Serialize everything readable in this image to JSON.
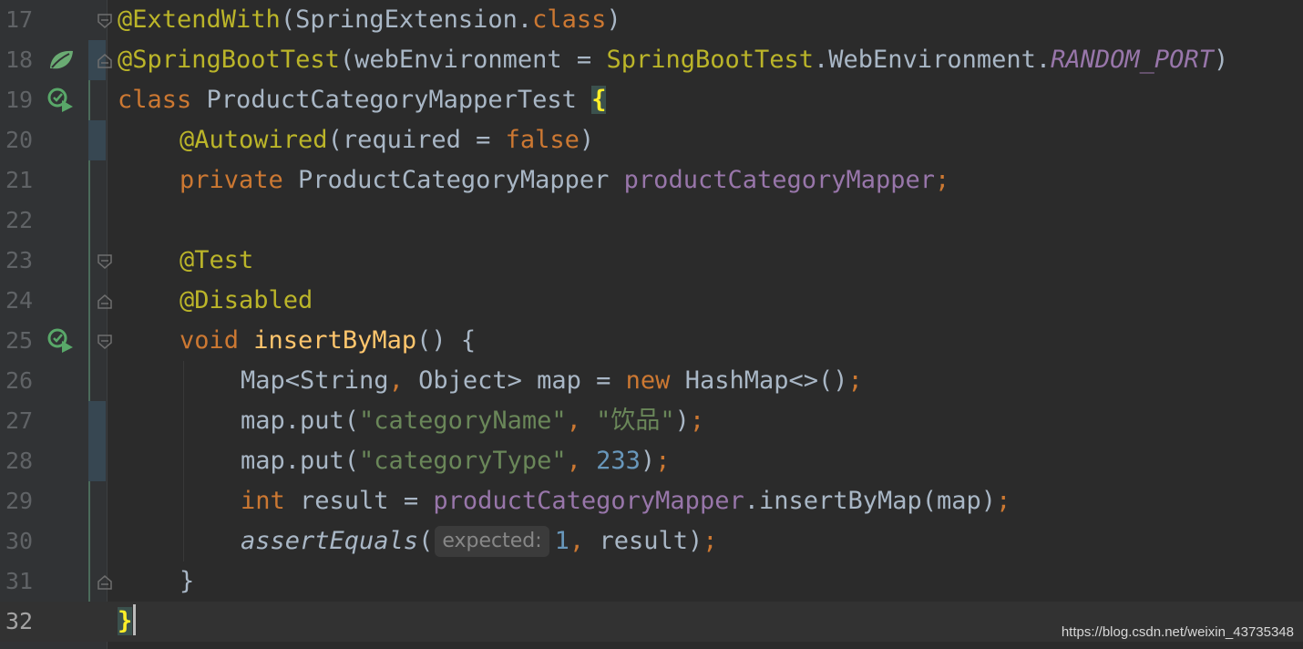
{
  "editor": {
    "lines": [
      {
        "num": "17"
      },
      {
        "num": "18"
      },
      {
        "num": "19"
      },
      {
        "num": "20"
      },
      {
        "num": "21"
      },
      {
        "num": "22"
      },
      {
        "num": "23"
      },
      {
        "num": "24"
      },
      {
        "num": "25"
      },
      {
        "num": "26"
      },
      {
        "num": "27"
      },
      {
        "num": "28"
      },
      {
        "num": "29"
      },
      {
        "num": "30"
      },
      {
        "num": "31"
      },
      {
        "num": "32"
      }
    ],
    "code": {
      "l17": {
        "a": "@ExtendWith",
        "b": "(SpringExtension.",
        "c": "class",
        "d": ")"
      },
      "l18": {
        "a": "@SpringBootTest",
        "b": "(webEnvironment = ",
        "c": "SpringBootTest",
        "d": ".WebEnvironment.",
        "e": "RANDOM_PORT",
        "f": ")"
      },
      "l19": {
        "a": "class ",
        "b": "ProductCategoryMapperTest ",
        "c": "{"
      },
      "l20": {
        "a": "@Autowired",
        "b": "(required = ",
        "c": "false",
        "d": ")"
      },
      "l21": {
        "a": "private ",
        "b": "ProductCategoryMapper ",
        "c": "productCategoryMapper",
        "d": ";"
      },
      "l23": {
        "a": "@Test"
      },
      "l24": {
        "a": "@Disabled"
      },
      "l25": {
        "a": "void ",
        "b": "insertByMap",
        "c": "() {"
      },
      "l26": {
        "a": "Map<String",
        "b": ", ",
        "c": "Object> map = ",
        "d": "new ",
        "e": "HashMap<>()",
        "f": ";"
      },
      "l27": {
        "a": "map.put(",
        "b": "\"categoryName\"",
        "c": ", ",
        "d": "\"饮品\"",
        "e": ")",
        "f": ";"
      },
      "l28": {
        "a": "map.put(",
        "b": "\"categoryType\"",
        "c": ", ",
        "d": "233",
        "e": ")",
        "f": ";"
      },
      "l29": {
        "a": "int ",
        "b": "result = ",
        "c": "productCategoryMapper",
        "d": ".insertByMap(map)",
        "e": ";"
      },
      "l30": {
        "a": "assertEquals",
        "b": "(",
        "hint": "expected:",
        "c": "1",
        "d": ", ",
        "e": "result)",
        "f": ";"
      },
      "l31": {
        "a": "}"
      },
      "l32": {
        "a": "}"
      }
    }
  },
  "icons": {
    "run": "run-test-icon",
    "bean": "spring-bean-icon",
    "fold": "fold-icon"
  },
  "colors": {
    "background": "#2b2b2b",
    "annotation": "#bbb529",
    "keyword": "#cc7832",
    "field": "#9876aa",
    "string": "#6a8759",
    "number": "#6897bb"
  },
  "watermark": "https://blog.csdn.net/weixin_43735348"
}
